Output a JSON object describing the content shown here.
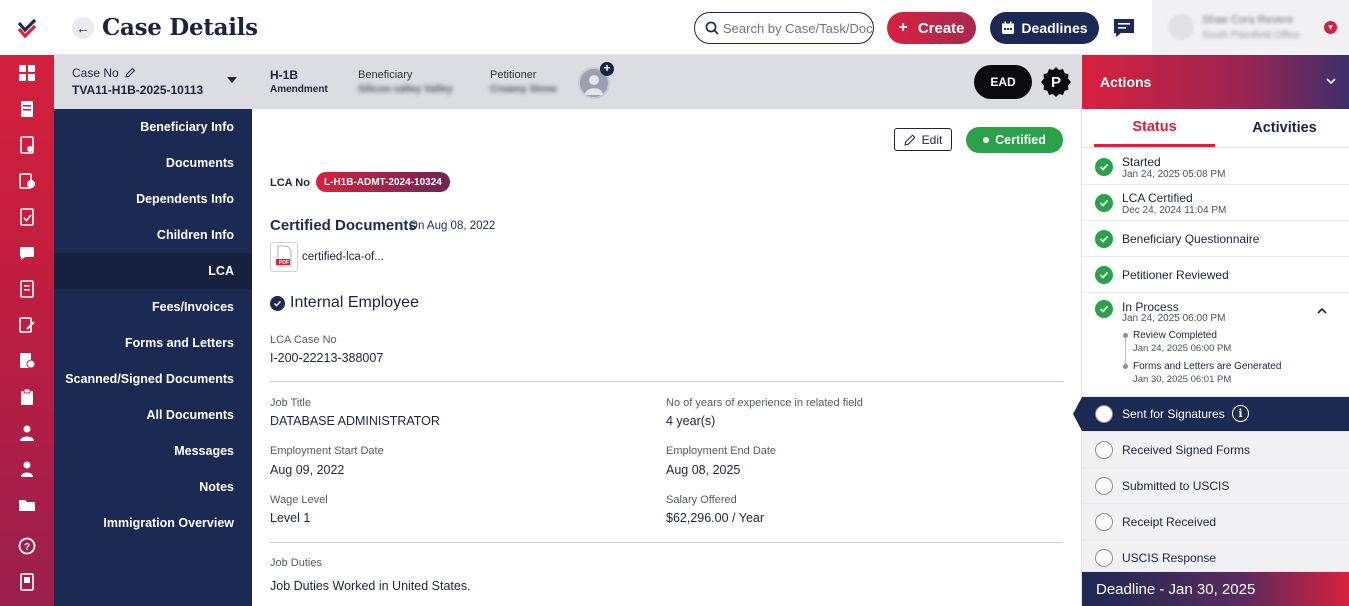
{
  "header": {
    "title": "Case Details",
    "search_placeholder": "Search by Case/Task/Document",
    "create_label": "Create",
    "deadlines_label": "Deadlines",
    "user_name": "Shae Cora Revere",
    "user_office": "South Plainfield Office"
  },
  "case_bar": {
    "case_no_label": "Case No",
    "case_no": "TVA11-H1B-2025-10113",
    "visa_type": "H-1B",
    "visa_subtype": "Amendment",
    "beneficiary_label": "Beneficiary",
    "beneficiary_value": "Silicon valley Valley",
    "petitioner_label": "Petitioner",
    "petitioner_value": "Creamy Stone",
    "ead_label": "EAD",
    "p_badge": "P"
  },
  "section_nav": [
    {
      "label": "Beneficiary Info"
    },
    {
      "label": "Documents"
    },
    {
      "label": "Dependents Info"
    },
    {
      "label": "Children Info"
    },
    {
      "label": "LCA"
    },
    {
      "label": "Fees/Invoices"
    },
    {
      "label": "Forms and Letters"
    },
    {
      "label": "Scanned/Signed Documents"
    },
    {
      "label": "All Documents"
    },
    {
      "label": "Messages"
    },
    {
      "label": "Notes"
    },
    {
      "label": "Immigration Overview"
    }
  ],
  "main": {
    "edit_label": "Edit",
    "status_badge": "Certified",
    "lca_no_label": "LCA No",
    "lca_no": "L-H1B-ADMT-2024-10324",
    "cert_docs_title": "Certified Documents",
    "cert_docs_date": "On Aug 08, 2022",
    "pdf_label": "PDF",
    "file_name": "certified-lca-of...",
    "employee_type": "Internal Employee",
    "lca_case_no_label": "LCA Case No",
    "lca_case_no": "I-200-22213-388007",
    "job_title_label": "Job Title",
    "job_title": "DATABASE ADMINISTRATOR",
    "experience_label": "No of years of experience in related field",
    "experience": "4 year(s)",
    "start_label": "Employment Start Date",
    "start": "Aug 09, 2022",
    "end_label": "Employment End Date",
    "end": "Aug 08, 2025",
    "wage_label": "Wage Level",
    "wage": "Level 1",
    "salary_label": "Salary Offered",
    "salary": "$62,296.00 / Year",
    "duties_label": "Job Duties",
    "duties": "Job Duties Worked in United States."
  },
  "actions": {
    "title": "Actions",
    "tab_status": "Status",
    "tab_activities": "Activities",
    "steps": [
      {
        "name": "Started",
        "date": "Jan 24, 2025 05:08 PM"
      },
      {
        "name": "LCA Certified",
        "date": "Dec 24, 2024 11:04 PM"
      },
      {
        "name": "Beneficiary Questionnaire"
      },
      {
        "name": "Petitioner Reviewed"
      },
      {
        "name": "In Process",
        "date": "Jan 24, 2025 06:00 PM"
      },
      {
        "name": "Sent for Signatures"
      },
      {
        "name": "Received Signed Forms"
      },
      {
        "name": "Submitted to USCIS"
      },
      {
        "name": "Receipt Received"
      },
      {
        "name": "USCIS Response"
      }
    ],
    "substeps": [
      {
        "name": "Review Completed",
        "date": "Jan 24, 2025 06:00 PM"
      },
      {
        "name": "Forms and Letters are Generated",
        "date": "Jan 30, 2025 06:01 PM"
      }
    ],
    "deadline": "Deadline - Jan 30, 2025"
  },
  "colors": {
    "brand_red": "#d8213d",
    "navy": "#1c2952",
    "success": "#2aa14a"
  }
}
